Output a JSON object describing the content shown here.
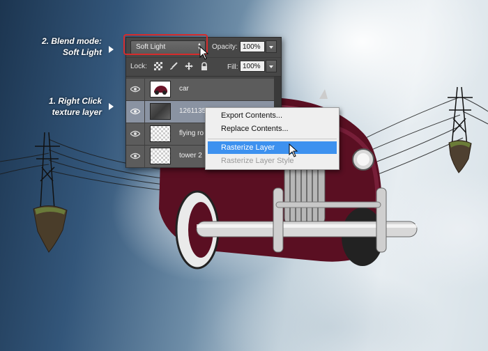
{
  "annotations": {
    "step2_line1": "2. Blend mode:",
    "step2_line2": "Soft Light",
    "step1_line1": "1. Right Click",
    "step1_line2": "texture layer"
  },
  "layers_panel": {
    "blend_mode": "Soft Light",
    "opacity_label": "Opacity:",
    "opacity_value": "100%",
    "lock_label": "Lock:",
    "fill_label": "Fill:",
    "fill_value": "100%",
    "layers": [
      {
        "name": "car",
        "thumbnail": "car-image",
        "selected": false
      },
      {
        "name": "1261135",
        "thumbnail": "texture-image",
        "selected": true
      },
      {
        "name": "flying ro",
        "thumbnail": "transparent",
        "selected": false
      },
      {
        "name": "tower 2",
        "thumbnail": "transparent",
        "selected": false
      }
    ]
  },
  "context_menu": {
    "items": [
      {
        "label": "Export Contents...",
        "state": "normal"
      },
      {
        "label": "Replace Contents...",
        "state": "normal"
      },
      {
        "label": "Rasterize Layer",
        "state": "highlighted"
      },
      {
        "label": "Rasterize Layer Style",
        "state": "disabled"
      }
    ]
  },
  "colors": {
    "highlight": "#3d91ef",
    "annotation_box": "#d62b2b",
    "panel_bg": "#474747",
    "selected_layer": "#8a93a2"
  }
}
